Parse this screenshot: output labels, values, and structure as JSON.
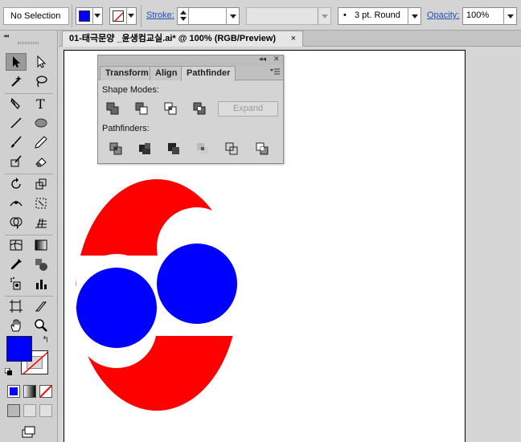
{
  "control_bar": {
    "selection_label": "No Selection",
    "fill_color": "#0000ff",
    "stroke_label": "Stroke:",
    "stroke_weight": "",
    "variable_width": "",
    "brush_label": "3 pt. Round",
    "brush_dot": "•",
    "opacity_label": "Opacity:",
    "opacity_value": "100%"
  },
  "document_tab": {
    "title": "01-태극문양 _윤생컴교실.ai* @ 100% (RGB/Preview)",
    "close": "×"
  },
  "toolbox": {
    "collapse": "◂◂",
    "fill_color": "#0000ff",
    "stroke_color": "none",
    "swap_glyph": "↰"
  },
  "pathfinder_panel": {
    "title_controls": [
      "◂◂",
      "✕"
    ],
    "tabs": [
      {
        "label": "Transform",
        "active": false
      },
      {
        "label": "Align",
        "active": false
      },
      {
        "label": "Pathfinder",
        "active": true
      }
    ],
    "shape_modes_label": "Shape Modes:",
    "shape_modes": [
      "unite-icon",
      "minus-front-icon",
      "intersect-icon",
      "exclude-icon"
    ],
    "expand_label": "Expand",
    "pathfinders_label": "Pathfinders:",
    "pathfinders": [
      "divide-icon",
      "trim-icon",
      "merge-icon",
      "crop-icon",
      "outline-icon",
      "minus-back-icon"
    ]
  },
  "artwork": {
    "colors": {
      "red": "#ff0000",
      "blue": "#0000ff",
      "white": "#ffffff"
    }
  }
}
